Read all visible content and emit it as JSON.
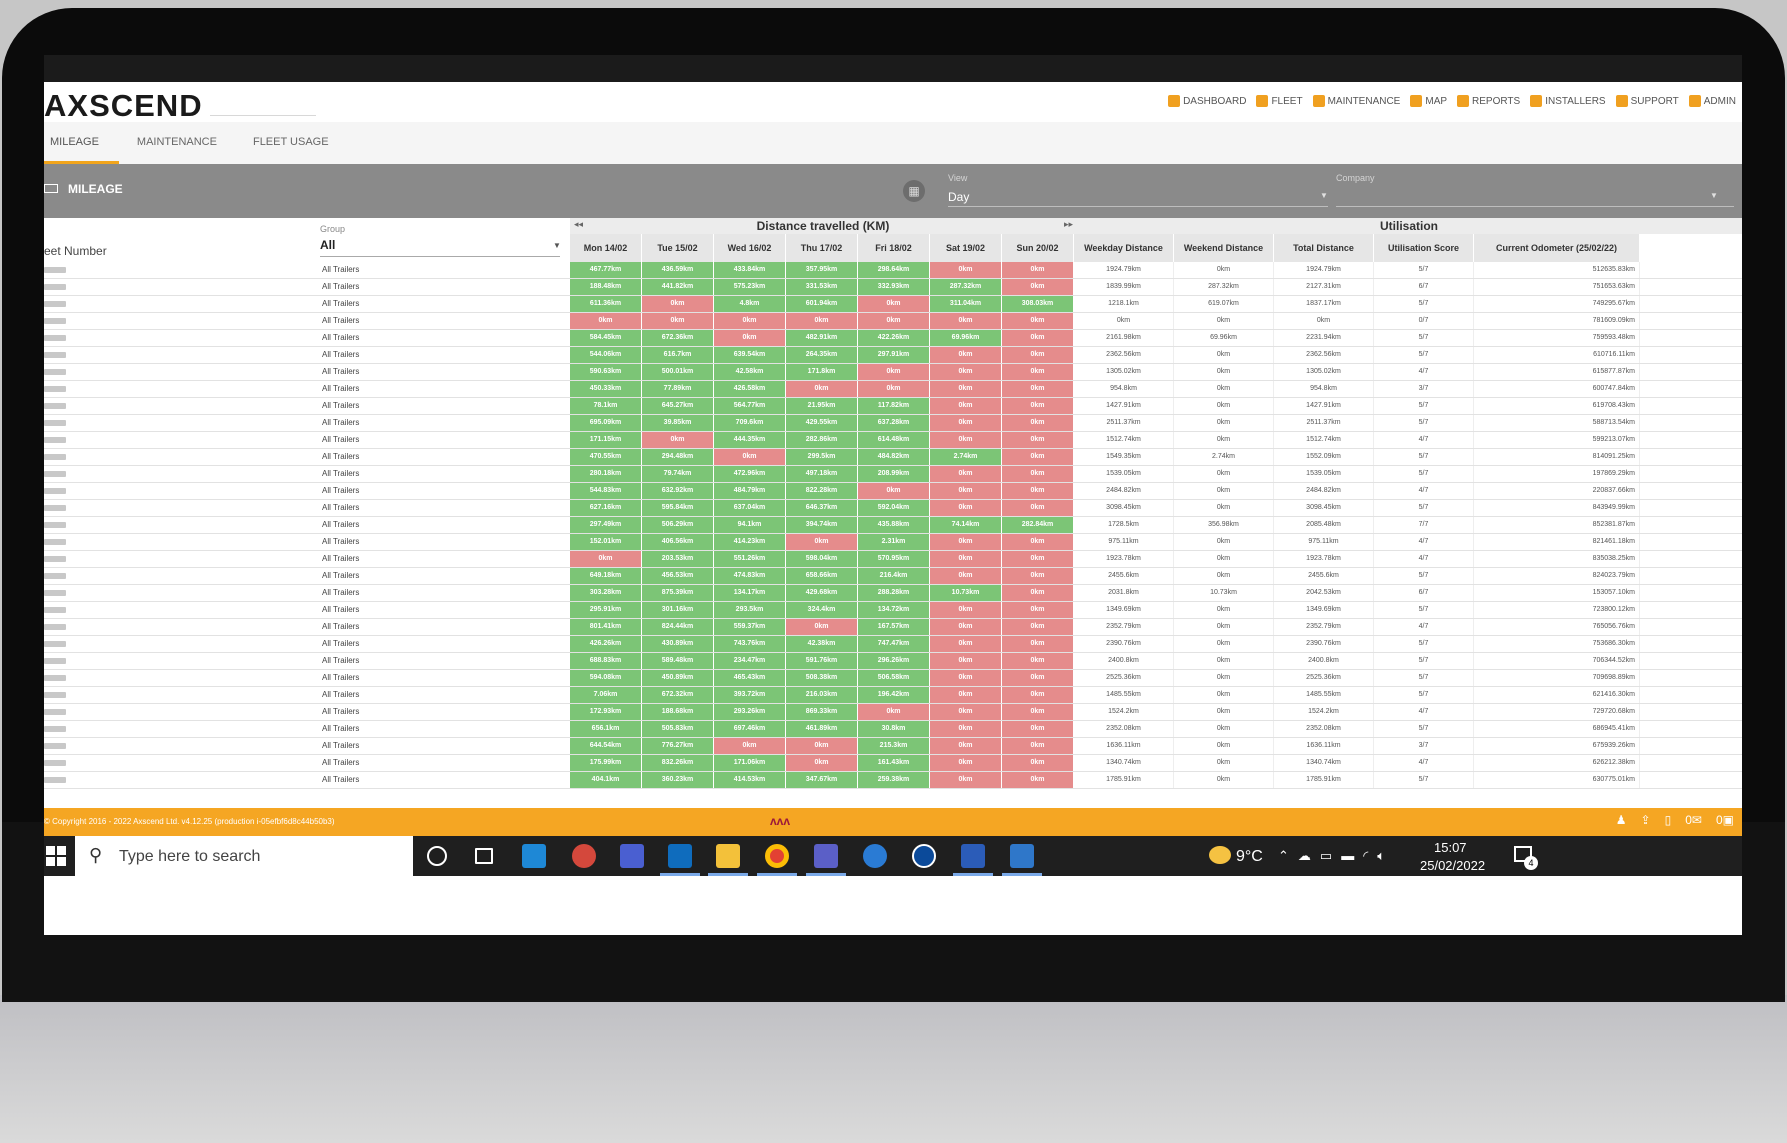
{
  "header": {
    "logo": "AXSCEND",
    "nav": [
      {
        "label": "DASHBOARD",
        "icon": "dashboard-icon"
      },
      {
        "label": "FLEET",
        "icon": "truck-icon"
      },
      {
        "label": "MAINTENANCE",
        "icon": "wrench-icon"
      },
      {
        "label": "MAP",
        "icon": "map-icon"
      },
      {
        "label": "REPORTS",
        "icon": "report-icon"
      },
      {
        "label": "INSTALLERS",
        "icon": "check-icon"
      },
      {
        "label": "SUPPORT",
        "icon": "support-icon"
      },
      {
        "label": "ADMIN",
        "icon": "lock-icon"
      }
    ]
  },
  "tabs": [
    "MILEAGE",
    "MAINTENANCE",
    "FLEET USAGE"
  ],
  "toolbar": {
    "title": "MILEAGE",
    "view_label": "View",
    "view_value": "Day",
    "company_label": "Company"
  },
  "table": {
    "fleet_header": "eet Number",
    "group_label": "Group",
    "group_value": "All",
    "distance_header": "Distance travelled (KM)",
    "util_header": "Utilisation",
    "day_headers": [
      "Mon 14/02",
      "Tue 15/02",
      "Wed 16/02",
      "Thu 17/02",
      "Fri 18/02",
      "Sat 19/02",
      "Sun 20/02"
    ],
    "util_headers": [
      "Weekday Distance",
      "Weekend Distance",
      "Total Distance",
      "Utilisation Score",
      "Current Odometer (25/02/22)"
    ],
    "rows": [
      {
        "group": "All Trailers",
        "days": [
          "467.77km",
          "436.59km",
          "433.84km",
          "357.95km",
          "298.64km",
          "0km",
          "0km"
        ],
        "util": [
          "1924.79km",
          "0km",
          "1924.79km",
          "5/7",
          "512635.83km"
        ]
      },
      {
        "group": "All Trailers",
        "days": [
          "188.48km",
          "441.82km",
          "575.23km",
          "331.53km",
          "332.93km",
          "287.32km",
          "0km"
        ],
        "util": [
          "1839.99km",
          "287.32km",
          "2127.31km",
          "6/7",
          "751653.63km"
        ]
      },
      {
        "group": "All Trailers",
        "days": [
          "611.36km",
          "0km",
          "4.8km",
          "601.94km",
          "0km",
          "311.04km",
          "308.03km"
        ],
        "util": [
          "1218.1km",
          "619.07km",
          "1837.17km",
          "5/7",
          "749295.67km"
        ]
      },
      {
        "group": "All Trailers",
        "days": [
          "0km",
          "0km",
          "0km",
          "0km",
          "0km",
          "0km",
          "0km"
        ],
        "util": [
          "0km",
          "0km",
          "0km",
          "0/7",
          "781609.09km"
        ]
      },
      {
        "group": "All Trailers",
        "days": [
          "584.45km",
          "672.36km",
          "0km",
          "482.91km",
          "422.26km",
          "69.96km",
          "0km"
        ],
        "util": [
          "2161.98km",
          "69.96km",
          "2231.94km",
          "5/7",
          "759593.48km"
        ]
      },
      {
        "group": "All Trailers",
        "days": [
          "544.06km",
          "616.7km",
          "639.54km",
          "264.35km",
          "297.91km",
          "0km",
          "0km"
        ],
        "util": [
          "2362.56km",
          "0km",
          "2362.56km",
          "5/7",
          "610716.11km"
        ]
      },
      {
        "group": "All Trailers",
        "days": [
          "590.63km",
          "500.01km",
          "42.58km",
          "171.8km",
          "0km",
          "0km",
          "0km"
        ],
        "util": [
          "1305.02km",
          "0km",
          "1305.02km",
          "4/7",
          "615877.87km"
        ]
      },
      {
        "group": "All Trailers",
        "days": [
          "450.33km",
          "77.89km",
          "426.58km",
          "0km",
          "0km",
          "0km",
          "0km"
        ],
        "util": [
          "954.8km",
          "0km",
          "954.8km",
          "3/7",
          "600747.84km"
        ]
      },
      {
        "group": "All Trailers",
        "days": [
          "78.1km",
          "645.27km",
          "564.77km",
          "21.95km",
          "117.82km",
          "0km",
          "0km"
        ],
        "util": [
          "1427.91km",
          "0km",
          "1427.91km",
          "5/7",
          "619708.43km"
        ]
      },
      {
        "group": "All Trailers",
        "days": [
          "695.09km",
          "39.85km",
          "709.6km",
          "429.55km",
          "637.28km",
          "0km",
          "0km"
        ],
        "util": [
          "2511.37km",
          "0km",
          "2511.37km",
          "5/7",
          "588713.54km"
        ]
      },
      {
        "group": "All Trailers",
        "days": [
          "171.15km",
          "0km",
          "444.35km",
          "282.86km",
          "614.48km",
          "0km",
          "0km"
        ],
        "util": [
          "1512.74km",
          "0km",
          "1512.74km",
          "4/7",
          "599213.07km"
        ]
      },
      {
        "group": "All Trailers",
        "days": [
          "470.55km",
          "294.48km",
          "0km",
          "299.5km",
          "484.82km",
          "2.74km",
          "0km"
        ],
        "util": [
          "1549.35km",
          "2.74km",
          "1552.09km",
          "5/7",
          "814091.25km"
        ]
      },
      {
        "group": "All Trailers",
        "days": [
          "280.18km",
          "79.74km",
          "472.96km",
          "497.18km",
          "208.99km",
          "0km",
          "0km"
        ],
        "util": [
          "1539.05km",
          "0km",
          "1539.05km",
          "5/7",
          "197869.29km"
        ]
      },
      {
        "group": "All Trailers",
        "days": [
          "544.83km",
          "632.92km",
          "484.79km",
          "822.28km",
          "0km",
          "0km",
          "0km"
        ],
        "util": [
          "2484.82km",
          "0km",
          "2484.82km",
          "4/7",
          "220837.66km"
        ]
      },
      {
        "group": "All Trailers",
        "days": [
          "627.16km",
          "595.84km",
          "637.04km",
          "646.37km",
          "592.04km",
          "0km",
          "0km"
        ],
        "util": [
          "3098.45km",
          "0km",
          "3098.45km",
          "5/7",
          "843949.99km"
        ]
      },
      {
        "group": "All Trailers",
        "days": [
          "297.49km",
          "506.29km",
          "94.1km",
          "394.74km",
          "435.88km",
          "74.14km",
          "282.84km"
        ],
        "util": [
          "1728.5km",
          "356.98km",
          "2085.48km",
          "7/7",
          "852381.87km"
        ]
      },
      {
        "group": "All Trailers",
        "days": [
          "152.01km",
          "406.56km",
          "414.23km",
          "0km",
          "2.31km",
          "0km",
          "0km"
        ],
        "util": [
          "975.11km",
          "0km",
          "975.11km",
          "4/7",
          "821461.18km"
        ]
      },
      {
        "group": "All Trailers",
        "days": [
          "0km",
          "203.53km",
          "551.26km",
          "598.04km",
          "570.95km",
          "0km",
          "0km"
        ],
        "util": [
          "1923.78km",
          "0km",
          "1923.78km",
          "4/7",
          "835038.25km"
        ]
      },
      {
        "group": "All Trailers",
        "days": [
          "649.18km",
          "456.53km",
          "474.83km",
          "658.66km",
          "216.4km",
          "0km",
          "0km"
        ],
        "util": [
          "2455.6km",
          "0km",
          "2455.6km",
          "5/7",
          "824023.79km"
        ]
      },
      {
        "group": "All Trailers",
        "days": [
          "303.28km",
          "875.39km",
          "134.17km",
          "429.68km",
          "288.28km",
          "10.73km",
          "0km"
        ],
        "util": [
          "2031.8km",
          "10.73km",
          "2042.53km",
          "6/7",
          "153057.10km"
        ]
      },
      {
        "group": "All Trailers",
        "days": [
          "295.91km",
          "301.16km",
          "293.5km",
          "324.4km",
          "134.72km",
          "0km",
          "0km"
        ],
        "util": [
          "1349.69km",
          "0km",
          "1349.69km",
          "5/7",
          "723800.12km"
        ]
      },
      {
        "group": "All Trailers",
        "days": [
          "801.41km",
          "824.44km",
          "559.37km",
          "0km",
          "167.57km",
          "0km",
          "0km"
        ],
        "util": [
          "2352.79km",
          "0km",
          "2352.79km",
          "4/7",
          "765056.76km"
        ]
      },
      {
        "group": "All Trailers",
        "days": [
          "426.26km",
          "430.89km",
          "743.76km",
          "42.38km",
          "747.47km",
          "0km",
          "0km"
        ],
        "util": [
          "2390.76km",
          "0km",
          "2390.76km",
          "5/7",
          "753686.30km"
        ]
      },
      {
        "group": "All Trailers",
        "days": [
          "688.83km",
          "589.48km",
          "234.47km",
          "591.76km",
          "296.26km",
          "0km",
          "0km"
        ],
        "util": [
          "2400.8km",
          "0km",
          "2400.8km",
          "5/7",
          "706344.52km"
        ]
      },
      {
        "group": "All Trailers",
        "days": [
          "594.08km",
          "450.89km",
          "465.43km",
          "508.38km",
          "506.58km",
          "0km",
          "0km"
        ],
        "util": [
          "2525.36km",
          "0km",
          "2525.36km",
          "5/7",
          "709698.89km"
        ]
      },
      {
        "group": "All Trailers",
        "days": [
          "7.06km",
          "672.32km",
          "393.72km",
          "216.03km",
          "196.42km",
          "0km",
          "0km"
        ],
        "util": [
          "1485.55km",
          "0km",
          "1485.55km",
          "5/7",
          "621416.30km"
        ]
      },
      {
        "group": "All Trailers",
        "days": [
          "172.93km",
          "188.68km",
          "293.26km",
          "869.33km",
          "0km",
          "0km",
          "0km"
        ],
        "util": [
          "1524.2km",
          "0km",
          "1524.2km",
          "4/7",
          "729720.68km"
        ]
      },
      {
        "group": "All Trailers",
        "days": [
          "656.1km",
          "505.83km",
          "697.46km",
          "461.89km",
          "30.8km",
          "0km",
          "0km"
        ],
        "util": [
          "2352.08km",
          "0km",
          "2352.08km",
          "5/7",
          "686945.41km"
        ]
      },
      {
        "group": "All Trailers",
        "days": [
          "644.54km",
          "776.27km",
          "0km",
          "0km",
          "215.3km",
          "0km",
          "0km"
        ],
        "util": [
          "1636.11km",
          "0km",
          "1636.11km",
          "3/7",
          "675939.26km"
        ]
      },
      {
        "group": "All Trailers",
        "days": [
          "175.99km",
          "832.26km",
          "171.06km",
          "0km",
          "161.43km",
          "0km",
          "0km"
        ],
        "util": [
          "1340.74km",
          "0km",
          "1340.74km",
          "4/7",
          "626212.38km"
        ]
      },
      {
        "group": "All Trailers",
        "days": [
          "404.1km",
          "360.23km",
          "414.53km",
          "347.67km",
          "259.38km",
          "0km",
          "0km"
        ],
        "util": [
          "1785.91km",
          "0km",
          "1785.91km",
          "5/7",
          "630775.01km"
        ]
      }
    ]
  },
  "footer": {
    "copyright": "© Copyright 2016 - 2022 Axscend Ltd. v4.12.25 (production i-05efbf6d8c44b50b3)",
    "badge_mail": "0",
    "badge_truck": "0"
  },
  "taskbar": {
    "search_placeholder": "Type here to search",
    "temperature": "9°C",
    "time": "15:07",
    "date": "25/02/2022",
    "notifications": "4"
  },
  "colors": {
    "accent": "#f5a623",
    "cell_green": "#7cc576",
    "cell_red": "#e58c8c",
    "toolbar": "#8a8a8a"
  }
}
